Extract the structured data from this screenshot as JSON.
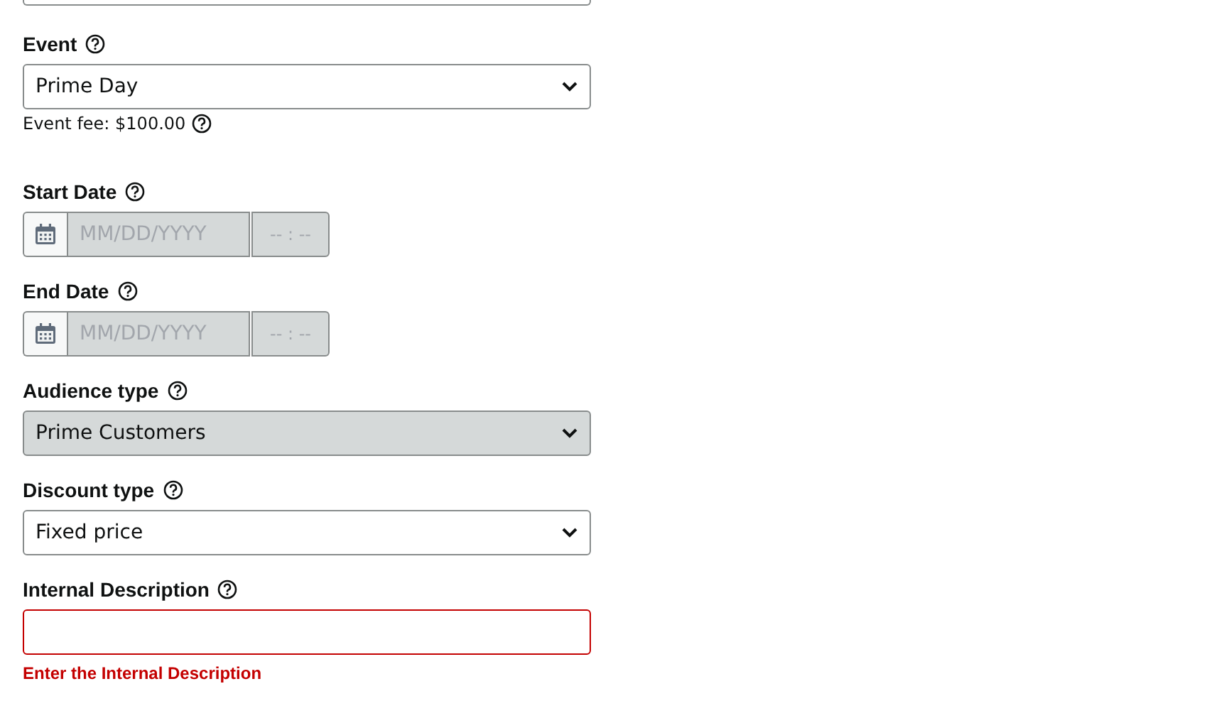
{
  "fields": [
    {
      "kind": "partial"
    },
    {
      "kind": "select",
      "label": "Event",
      "value": "Prime Day",
      "disabled": false,
      "note": "Event fee: $100.00"
    },
    {
      "kind": "date",
      "label": "Start Date",
      "date_placeholder": "MM/DD/YYYY",
      "time_placeholder": "-- : --",
      "disabled": true
    },
    {
      "kind": "date",
      "label": "End Date",
      "date_placeholder": "MM/DD/YYYY",
      "time_placeholder": "-- : --",
      "disabled": true
    },
    {
      "kind": "select",
      "label": "Audience type",
      "value": "Prime Customers",
      "disabled": true
    },
    {
      "kind": "select",
      "label": "Discount type",
      "value": "Fixed price",
      "disabled": false
    },
    {
      "kind": "text",
      "label": "Internal Description",
      "error": "Enter the Internal Description"
    }
  ]
}
